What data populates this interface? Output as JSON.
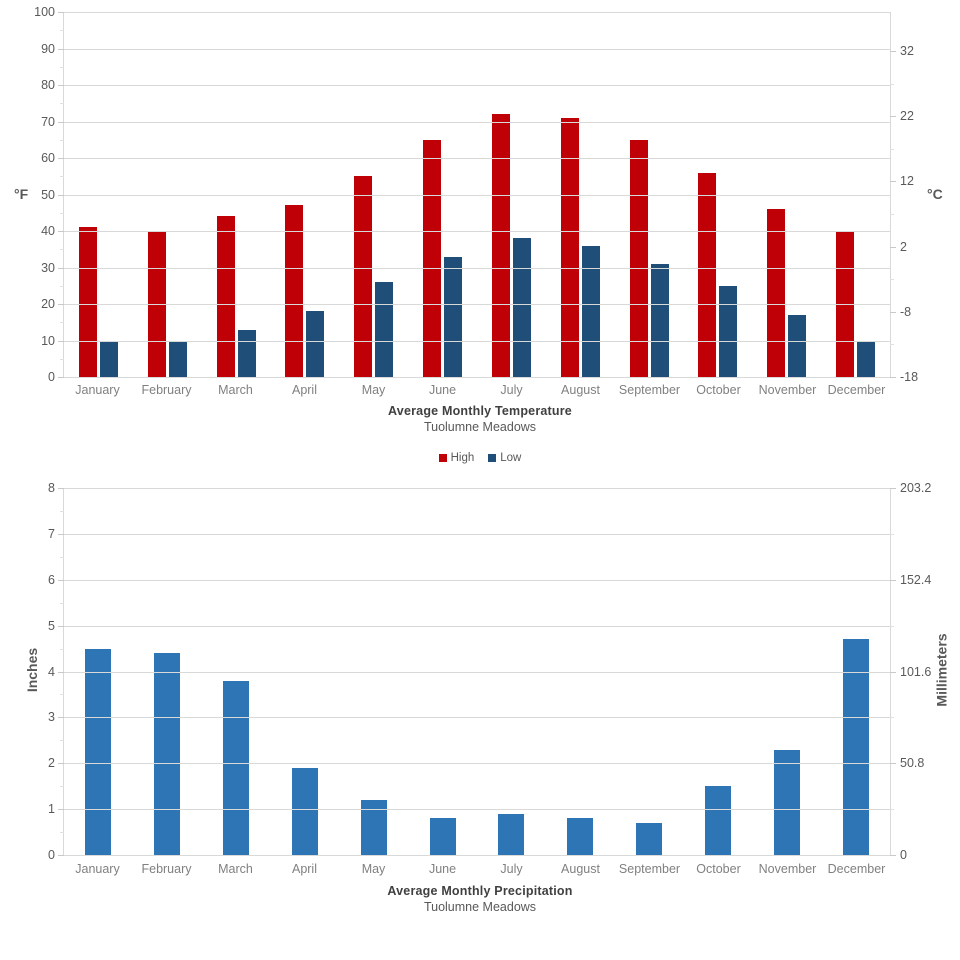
{
  "chart_data": [
    {
      "type": "bar",
      "title": "Average Monthly Temperature",
      "subtitle": "Tuolumne Meadows",
      "categories": [
        "January",
        "February",
        "March",
        "April",
        "May",
        "June",
        "July",
        "August",
        "September",
        "October",
        "November",
        "December"
      ],
      "series": [
        {
          "name": "High",
          "color": "#C00007",
          "values": [
            41,
            40,
            44,
            47,
            55,
            65,
            72,
            71,
            65,
            56,
            46,
            40
          ]
        },
        {
          "name": "Low",
          "color": "#1F4E79",
          "values": [
            10,
            10,
            13,
            18,
            26,
            33,
            38,
            36,
            31,
            25,
            17,
            10
          ]
        }
      ],
      "xlabel": "",
      "ylabel": "°F",
      "ylabel_right": "°C",
      "ylim": [
        0,
        100
      ],
      "ylim_right": [
        -18,
        38
      ],
      "yticks": [
        0,
        10,
        20,
        30,
        40,
        50,
        60,
        70,
        80,
        90,
        100
      ],
      "yticks_right": [
        -18,
        -8,
        2,
        12,
        22,
        32
      ],
      "ytick_labels": [
        "0",
        "10",
        "20",
        "30",
        "40",
        "50",
        "60",
        "70",
        "80",
        "90",
        "100"
      ],
      "ytick_labels_right": [
        "-18",
        "-8",
        "2",
        "12",
        "22",
        "32"
      ],
      "grid": true,
      "legend": "bottom"
    },
    {
      "type": "bar",
      "title": "Average Monthly  Precipitation",
      "subtitle": "Tuolumne Meadows",
      "categories": [
        "January",
        "February",
        "March",
        "April",
        "May",
        "June",
        "July",
        "August",
        "September",
        "October",
        "November",
        "December"
      ],
      "series": [
        {
          "name": "Precipitation",
          "color": "#2E75B6",
          "values": [
            4.5,
            4.4,
            3.8,
            1.9,
            1.2,
            0.8,
            0.9,
            0.8,
            0.7,
            1.5,
            2.3,
            4.7
          ]
        }
      ],
      "xlabel": "",
      "ylabel": "Inches",
      "ylabel_right": "Millimeters",
      "ylim": [
        0,
        8
      ],
      "ylim_right": [
        0,
        203.2
      ],
      "yticks": [
        0,
        1,
        2,
        3,
        4,
        5,
        6,
        7,
        8
      ],
      "yticks_right": [
        0,
        50.8,
        101.6,
        152.4,
        203.2
      ],
      "ytick_labels": [
        "0",
        "1",
        "2",
        "3",
        "4",
        "5",
        "6",
        "7",
        "8"
      ],
      "ytick_labels_right": [
        "0",
        "50.8",
        "101.6",
        "152.4",
        "203.2"
      ],
      "grid": true,
      "legend": "none"
    }
  ],
  "temperature_chart": {
    "axis_left_title": "°F",
    "axis_right_title": "°C",
    "title": "Average Monthly Temperature",
    "subtitle": "Tuolumne Meadows",
    "legend": [
      {
        "label": "High",
        "color": "#C00007"
      },
      {
        "label": "Low",
        "color": "#1F4E79"
      }
    ]
  },
  "precipitation_chart": {
    "axis_left_title": "Inches",
    "axis_right_title": "Millimeters",
    "title": "Average Monthly  Precipitation",
    "subtitle": "Tuolumne Meadows"
  }
}
